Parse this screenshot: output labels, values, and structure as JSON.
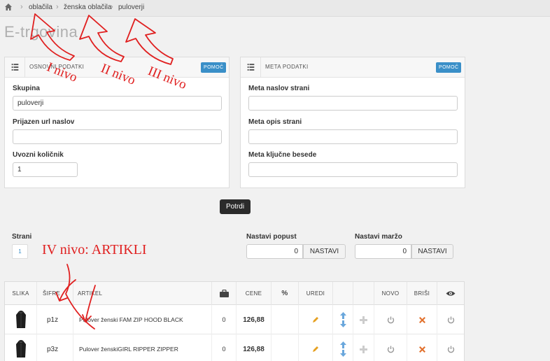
{
  "breadcrumb": {
    "items": [
      "oblačila",
      "ženska oblačila",
      "puloverji"
    ]
  },
  "page": {
    "title": "E-trgovina"
  },
  "basic": {
    "title": "OSNOVNI PODATKI",
    "help": "POMOČ",
    "group_label": "Skupina",
    "group_value": "puloverji",
    "url_label": "Prijazen url naslov",
    "url_value": "",
    "factor_label": "Uvozni količnik",
    "factor_value": "1"
  },
  "meta": {
    "title": "META PODATKI",
    "help": "POMOČ",
    "meta_title_label": "Meta naslov strani",
    "meta_desc_label": "Meta opis strani",
    "meta_keywords_label": "Meta ključne besede"
  },
  "confirm_label": "Potrdi",
  "pages": {
    "label": "Strani",
    "current": "1"
  },
  "discount": {
    "label": "Nastavi popust",
    "value": "0",
    "button": "NASTAVI"
  },
  "margin": {
    "label": "Nastavi maržo",
    "value": "0",
    "button": "NASTAVI"
  },
  "table": {
    "headers": {
      "image": "SLIKA",
      "code": "ŠIFRE",
      "article": "ARTIKEL",
      "price": "CENE",
      "percent": "%",
      "edit": "UREDI",
      "new": "NOVO",
      "delete": "BRIŠI"
    },
    "rows": [
      {
        "code": "p1z",
        "article": "Pulover ženski FAM ZIP HOOD BLACK",
        "stock": "0",
        "price": "126,88"
      },
      {
        "code": "p3z",
        "article": "Pulover ženskiGIRL RIPPER ZIPPER",
        "stock": "0",
        "price": "126,88"
      }
    ]
  },
  "annotations": {
    "level1": "I nivo",
    "level2": "II nivo",
    "level3": "III nivo",
    "level4": "IV nivo: ARTIKLI"
  },
  "icons": {
    "home": "home-icon",
    "list": "list-icon",
    "stock": "briefcase-icon",
    "eye": "eye-icon",
    "edit": "pencil-icon",
    "up": "arrow-up-icon",
    "down": "arrow-down-icon",
    "add": "plus-icon",
    "power": "power-icon",
    "delete": "x-icon"
  },
  "colors": {
    "help": "#3a8fc8",
    "annotation": "#e02020",
    "delete": "#e2712d",
    "edit": "#e6a020",
    "arrow": "#6aa7dc"
  }
}
